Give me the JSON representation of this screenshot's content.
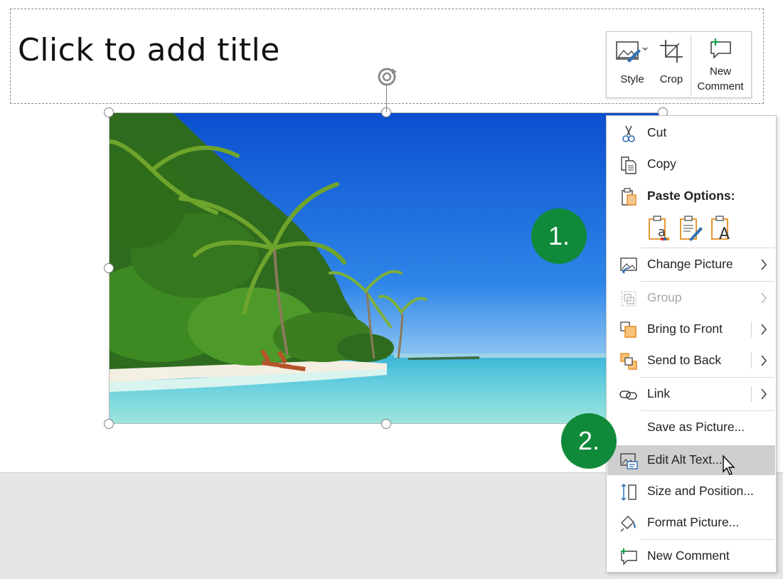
{
  "slide": {
    "title_placeholder": "Click to add title"
  },
  "mini_toolbar": {
    "style_label": "Style",
    "crop_label": "Crop",
    "new_comment_label_line1": "New",
    "new_comment_label_line2": "Comment"
  },
  "context_menu": {
    "items": [
      {
        "label": "Cut",
        "icon": "scissors-icon"
      },
      {
        "label": "Copy",
        "icon": "copy-icon"
      },
      {
        "label": "Paste Options:",
        "icon": "clipboard-icon"
      },
      {
        "label": "Change Picture",
        "icon": "change-picture-icon",
        "submenu": true
      },
      {
        "label": "Group",
        "icon": "group-icon",
        "submenu": true,
        "disabled": true
      },
      {
        "label": "Bring to Front",
        "icon": "bring-to-front-icon",
        "submenu": true
      },
      {
        "label": "Send to Back",
        "icon": "send-to-back-icon",
        "submenu": true
      },
      {
        "label": "Link",
        "icon": "link-icon",
        "submenu": true
      },
      {
        "label": "Save as Picture...",
        "icon": ""
      },
      {
        "label": "Edit Alt Text...",
        "icon": "alt-text-icon",
        "highlighted": true
      },
      {
        "label": "Size and Position...",
        "icon": "size-position-icon"
      },
      {
        "label": "Format Picture...",
        "icon": "format-picture-icon"
      },
      {
        "label": "New Comment",
        "icon": "new-comment-icon"
      }
    ],
    "paste_options": [
      "keep-source-formatting-icon",
      "use-destination-theme-icon",
      "keep-text-only-icon"
    ]
  },
  "annotations": {
    "step1": "1.",
    "step2": "2."
  },
  "colors": {
    "badge_green": "#108a3a",
    "menu_highlight": "#cfcfcf",
    "accent_blue": "#2f6fb5",
    "accent_orange": "#e38b1d"
  }
}
